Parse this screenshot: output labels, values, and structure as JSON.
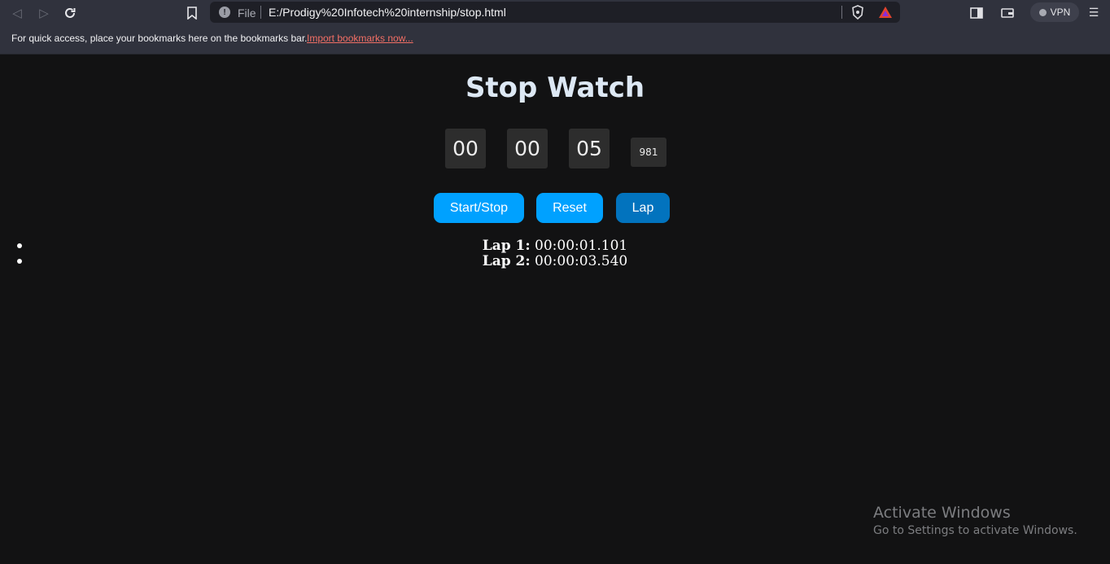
{
  "browser": {
    "file_label": "File",
    "url": "E:/Prodigy%20Infotech%20internship/stop.html",
    "vpn_label": "VPN",
    "bookmarks_bar_text": "For quick access, place your bookmarks here on the bookmarks bar.",
    "import_bookmarks_link": "Import bookmarks now..."
  },
  "page": {
    "title": "Stop Watch",
    "time": {
      "hours": "00",
      "minutes": "00",
      "seconds": "05",
      "milliseconds": "981"
    },
    "buttons": {
      "start_stop": "Start/Stop",
      "reset": "Reset",
      "lap": "Lap"
    },
    "laps": [
      {
        "label": "Lap 1:",
        "time": "00:00:01.101"
      },
      {
        "label": "Lap 2:",
        "time": "00:00:03.540"
      }
    ]
  },
  "colors": {
    "page_background": "#121213",
    "title_color": "#dde8f4",
    "button_primary": "#00a1ff",
    "button_lap": "#0273be",
    "digit_box": "#2d2d2d",
    "link_color": "#f36f65"
  },
  "watermark": {
    "line1": "Activate Windows",
    "line2": "Go to Settings to activate Windows."
  }
}
